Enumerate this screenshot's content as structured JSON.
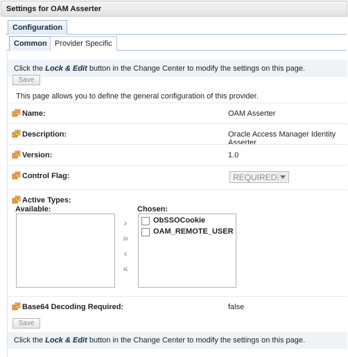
{
  "window": {
    "title": "Settings for OAM Asserter"
  },
  "tabs": {
    "outer": [
      "Configuration"
    ],
    "inner": [
      "Common",
      "Provider Specific"
    ]
  },
  "info_message": {
    "before": "Click the ",
    "emphasis": "Lock & Edit",
    "after": " button in the Change Center to modify the settings on this page."
  },
  "save_label": "Save",
  "intro": "This page allows you to define the general configuration of this provider.",
  "fields": {
    "name": {
      "label": "Name:",
      "value": "OAM Asserter"
    },
    "description": {
      "label": "Description:",
      "value": "Oracle Access Manager Identity Asserter"
    },
    "version": {
      "label": "Version:",
      "value": "1.0"
    },
    "control_flag": {
      "label": "Control Flag:",
      "value": "REQUIRED"
    },
    "active_types": {
      "label": "Active Types:",
      "available_label": "Available:",
      "chosen_label": "Chosen:",
      "available": [],
      "chosen": [
        "ObSSOCookie",
        "OAM_REMOTE_USER"
      ]
    },
    "base64": {
      "label": "Base64 Decoding Required:",
      "value": "false"
    }
  },
  "shuttle_icons": [
    "move-right-icon",
    "move-all-right-icon",
    "move-left-icon",
    "move-all-left-icon"
  ],
  "colors": {
    "info_bg": "#eef3f8",
    "tab_border": "#9fb5cc",
    "help_icon": "#d47b1a"
  }
}
